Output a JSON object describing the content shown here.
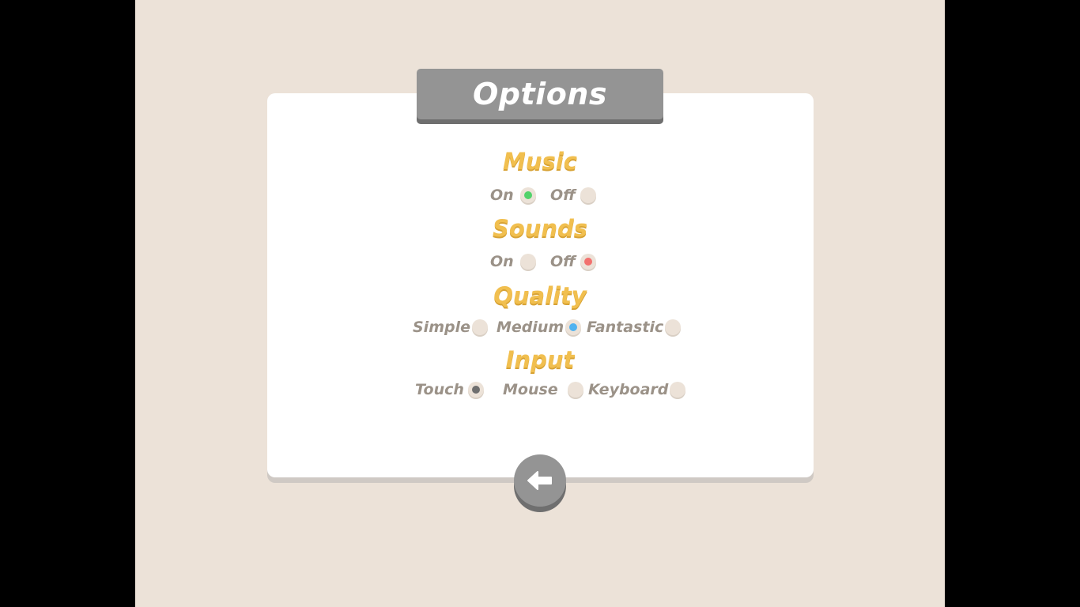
{
  "title": "Options",
  "sections": {
    "music": {
      "heading": "Music",
      "options": [
        "On",
        "Off"
      ],
      "selected": "On",
      "selected_color": "#52d26b"
    },
    "sounds": {
      "heading": "Sounds",
      "options": [
        "On",
        "Off"
      ],
      "selected": "Off",
      "selected_color": "#f2716e"
    },
    "quality": {
      "heading": "Quality",
      "options": [
        "Simple",
        "Medium",
        "Fantastic"
      ],
      "selected": "Medium",
      "selected_color": "#4fb2f0"
    },
    "input": {
      "heading": "Input",
      "options": [
        "Touch",
        "Mouse",
        "Keyboard"
      ],
      "selected": "Touch",
      "selected_color": "#6f6f6f"
    }
  },
  "back_button": {
    "icon": "arrow-left-icon"
  },
  "colors": {
    "background": "#ece2d8",
    "panel": "#ffffff",
    "heading": "#f1bf4f",
    "label": "#9b9288",
    "tab": "#949494"
  }
}
